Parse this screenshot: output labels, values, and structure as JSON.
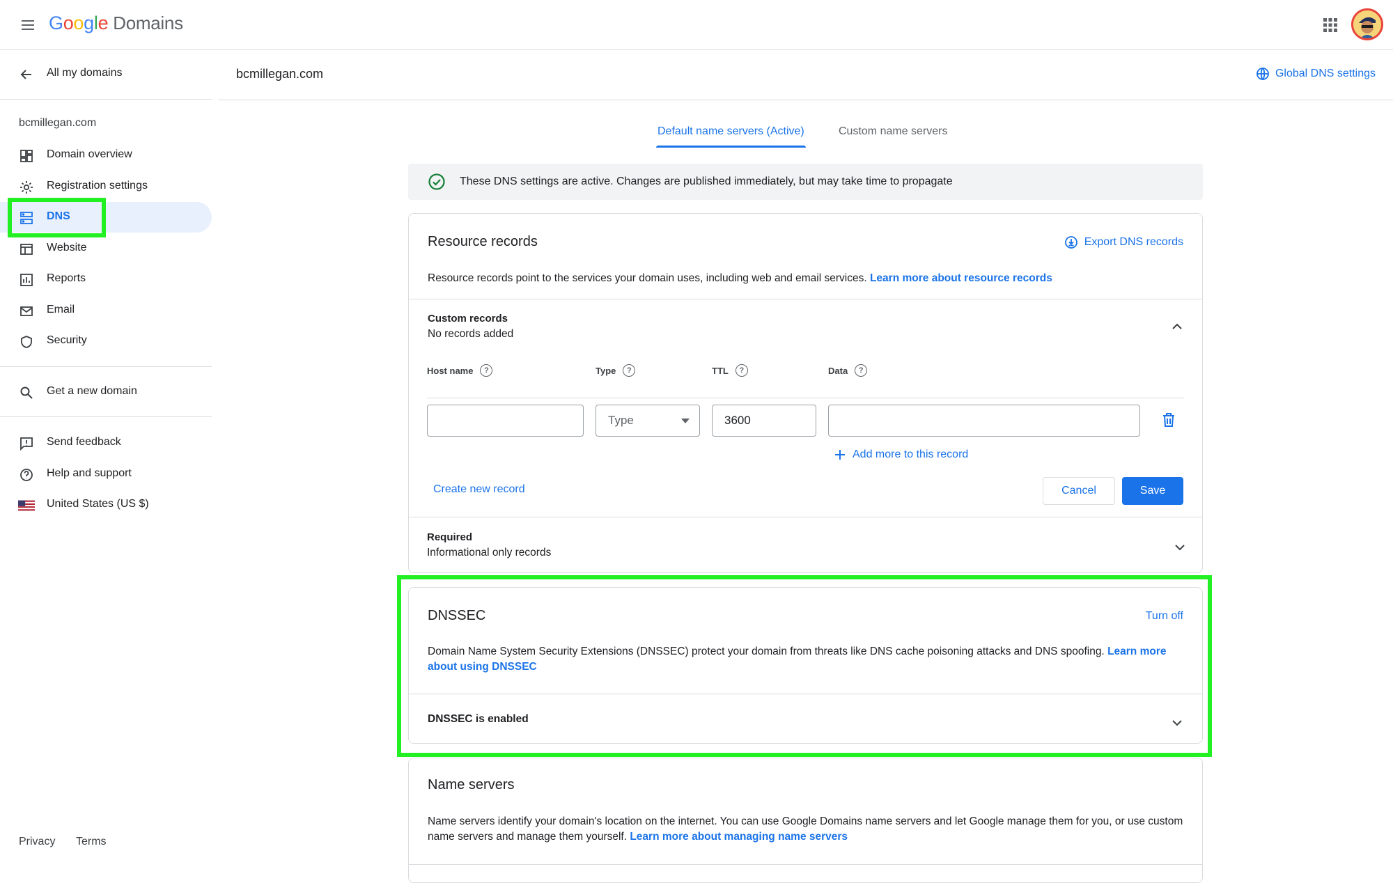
{
  "topbar": {
    "logo_google": [
      "G",
      "o",
      "o",
      "g",
      "l",
      "e"
    ],
    "logo_google_colors": [
      "#4285f4",
      "#ea4335",
      "#fbbc05",
      "#4285f4",
      "#34a853",
      "#ea4335"
    ],
    "logo_product": "Domains",
    "menu_icon": "menu-icon",
    "apps_icon": "apps-grid-icon",
    "avatar_icon": "avatar"
  },
  "sidebar": {
    "back_label": "All my domains",
    "domain": "bcmillegan.com",
    "items": [
      {
        "label": "Domain overview",
        "icon": "dashboard-icon"
      },
      {
        "label": "Registration settings",
        "icon": "gear-icon"
      },
      {
        "label": "DNS",
        "icon": "dns-icon",
        "active": true
      },
      {
        "label": "Website",
        "icon": "website-icon"
      },
      {
        "label": "Reports",
        "icon": "reports-icon"
      },
      {
        "label": "Email",
        "icon": "email-icon"
      },
      {
        "label": "Security",
        "icon": "shield-icon"
      }
    ],
    "get_domain": "Get a new domain",
    "feedback": "Send feedback",
    "help": "Help and support",
    "locale": "United States (US $)",
    "footer_privacy": "Privacy",
    "footer_terms": "Terms"
  },
  "header": {
    "domain": "bcmillegan.com",
    "global_dns": "Global DNS settings"
  },
  "tabs": {
    "default": "Default name servers (Active)",
    "custom": "Custom name servers"
  },
  "banner": {
    "text": "These DNS settings are active. Changes are published immediately, but may take time to propagate"
  },
  "resource_records": {
    "title": "Resource records",
    "export": "Export DNS records",
    "desc": "Resource records point to the services your domain uses, including web and email services.",
    "desc_link": "Learn more about resource records",
    "custom_title": "Custom records",
    "custom_sub": "No records added",
    "columns": [
      "Host name",
      "Type",
      "TTL",
      "Data"
    ],
    "hostname_value": "",
    "type_value": "Type",
    "ttl_value": "3600",
    "data_value": "",
    "add_more": "Add more to this record",
    "create_new": "Create new record",
    "cancel": "Cancel",
    "save": "Save",
    "required_title": "Required",
    "required_sub": "Informational only records"
  },
  "dnssec": {
    "title": "DNSSEC",
    "turn_off": "Turn off",
    "desc": "Domain Name System Security Extensions (DNSSEC) protect your domain from threats like DNS cache poisoning attacks and DNS spoofing.",
    "desc_link": "Learn more about using DNSSEC",
    "status": "DNSSEC is enabled"
  },
  "name_servers": {
    "title": "Name servers",
    "desc": "Name servers identify your domain's location on the internet. You can use Google Domains name servers and let Google manage them for you, or use custom name servers and manage them yourself.",
    "desc_link": "Learn more about managing name servers"
  },
  "colors": {
    "accent": "#1a73e8",
    "highlight": "#22f022"
  }
}
